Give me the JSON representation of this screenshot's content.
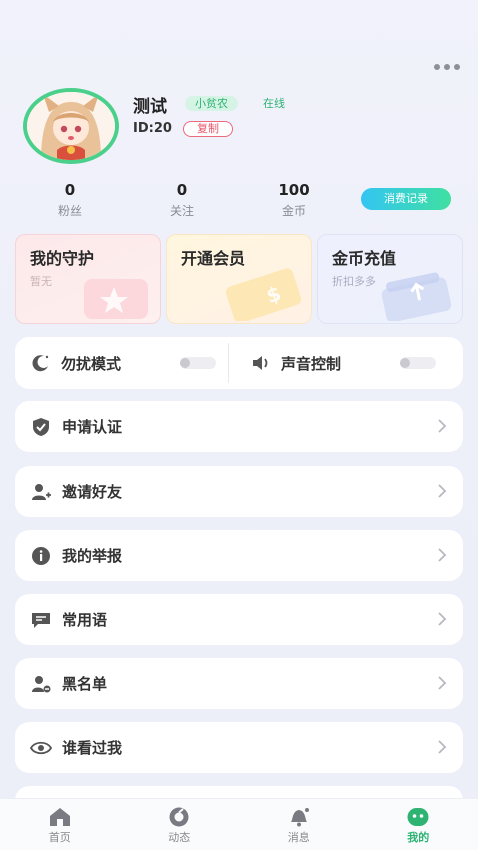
{
  "profile": {
    "name": "测试",
    "level_tag": "小贫农",
    "status": "在线",
    "id_text": "ID:20",
    "copy_label": "复制"
  },
  "stats": [
    {
      "value": "0",
      "label": "粉丝"
    },
    {
      "value": "0",
      "label": "关注"
    },
    {
      "value": "100",
      "label": "金币"
    }
  ],
  "record_button": "消费记录",
  "cards": {
    "guard": {
      "title": "我的守护",
      "subtitle": "暂无"
    },
    "vip": {
      "title": "开通会员",
      "subtitle": ""
    },
    "coin": {
      "title": "金币充值",
      "subtitle": "折扣多多"
    }
  },
  "toggles": {
    "dnd": {
      "label": "勿扰模式",
      "on": false
    },
    "sound": {
      "label": "声音控制",
      "on": false
    }
  },
  "menu": [
    {
      "label": "申请认证",
      "icon": "shield-check-icon"
    },
    {
      "label": "邀请好友",
      "icon": "user-plus-icon"
    },
    {
      "label": "我的举报",
      "icon": "info-icon"
    },
    {
      "label": "常用语",
      "icon": "chat-icon"
    },
    {
      "label": "黑名单",
      "icon": "user-block-icon"
    },
    {
      "label": "谁看过我",
      "icon": "eye-icon"
    }
  ],
  "tabs": [
    {
      "label": "首页",
      "icon": "home-icon"
    },
    {
      "label": "动态",
      "icon": "moments-icon"
    },
    {
      "label": "消息",
      "icon": "bell-icon"
    },
    {
      "label": "我的",
      "icon": "profile-icon",
      "active": true
    }
  ],
  "colors": {
    "accent_green": "#2eb373",
    "copy_red": "#e85468",
    "record_gradient_start": "#34c5f3",
    "record_gradient_end": "#3fe0a0"
  }
}
